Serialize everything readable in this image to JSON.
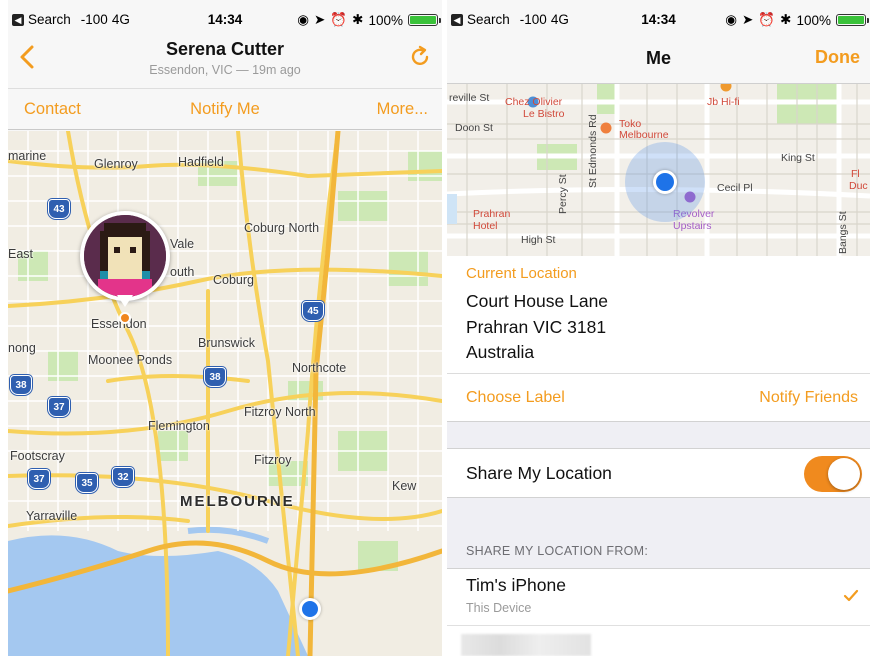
{
  "status_bar": {
    "back_app": "Search",
    "signal": "-100",
    "network": "4G",
    "time": "14:34",
    "battery": "100%",
    "battery_level": 1.0
  },
  "left": {
    "nav": {
      "title": "Serena Cutter",
      "subtitle": "Essendon, VIC — 19m ago"
    },
    "toolbar": {
      "contact": "Contact",
      "notify_me": "Notify Me",
      "more": "More..."
    },
    "map_labels": [
      "marine",
      "Glenroy",
      "Hadfield",
      "Coburg North",
      "East",
      "Pascoe Vale",
      "Vale",
      "outh",
      "Coburg",
      "Essendon",
      "Brunswick",
      "nong",
      "Moonee Ponds",
      "Northcote",
      "Flemington",
      "Fitzroy North",
      "Footscray",
      "Fitzroy",
      "Kew",
      "MELBOURNE",
      "Yarraville"
    ],
    "route_shields": [
      "43",
      "45",
      "38",
      "38",
      "37",
      "37",
      "35",
      "32"
    ]
  },
  "right": {
    "nav": {
      "title": "Me",
      "done": "Done"
    },
    "map_labels": [
      "reville St",
      "Chez Olivier",
      "Le Bistro",
      "Jb Hi-fi",
      "Toko",
      "Melbourne",
      "Doon St",
      "King St",
      "Cecil Pl",
      "Fl",
      "Duc",
      "Prahran",
      "Hotel",
      "Revolver",
      "Upstairs",
      "High St",
      "St Edmonds Rd",
      "Percy St",
      "Bangs St"
    ],
    "current_location": {
      "label": "Current Location",
      "line1": "Court House Lane",
      "line2": "Prahran VIC 3181",
      "line3": "Australia"
    },
    "actions": {
      "choose_label": "Choose Label",
      "notify_friends": "Notify Friends"
    },
    "share": {
      "label": "Share My Location",
      "enabled": true
    },
    "section_header": "SHARE MY LOCATION FROM:",
    "device": {
      "name": "Tim's iPhone",
      "subtitle": "This Device",
      "selected": true
    }
  },
  "colors": {
    "accent": "#f39c1f",
    "toggle_on": "#f08a1e",
    "location_blue": "#1e73e8",
    "shield_blue": "#2f5fb0"
  }
}
